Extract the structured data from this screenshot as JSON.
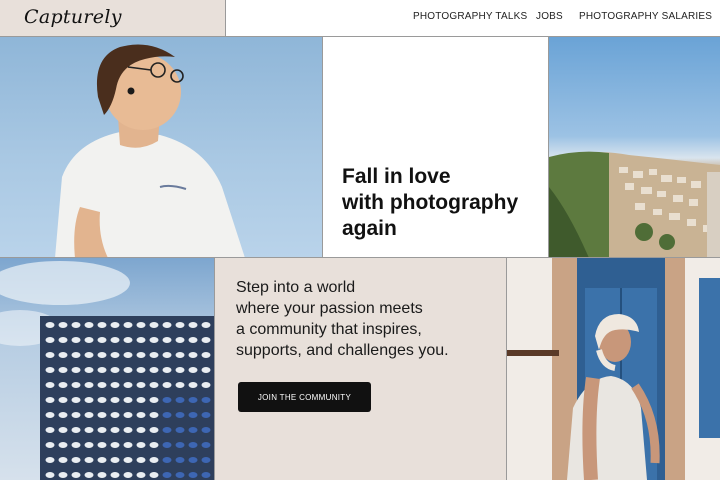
{
  "header": {
    "logo": "Capturely",
    "nav": [
      "PHOTOGRAPHY TALKS",
      "JOBS",
      "PHOTOGRAPHY SALARIES"
    ]
  },
  "hero": {
    "headline_lines": [
      "Fall in love",
      "with photography",
      "again"
    ]
  },
  "community": {
    "tagline_lines": [
      "Step into a world",
      "where your passion meets",
      "a community that inspires,",
      "supports, and challenges you."
    ],
    "button_label": "JOIN THE COMMUNITY"
  },
  "colors": {
    "accent_beige": "#e8e0da",
    "button_bg": "#111111",
    "button_text": "#ffffff"
  }
}
